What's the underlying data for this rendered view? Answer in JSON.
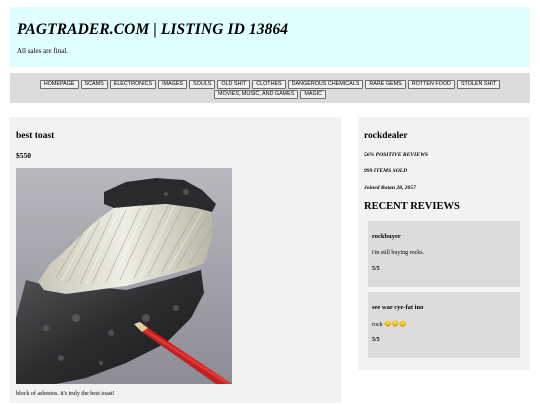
{
  "header": {
    "title": "PAGTRADER.COM | LISTING ID 13864",
    "subtitle": "All sales are final."
  },
  "nav": {
    "row1": [
      "HOMEPAGE",
      "SCAMS",
      "ELECTRONICS",
      "IMAGES",
      "SOULS",
      "OLD SHIT",
      "CLOTHES",
      "DANGEROUS CHEMICALS",
      "RARE GEMS",
      "ROTTEN FOOD",
      "STOLEN SHIT"
    ],
    "row2": [
      "MOVIES, MUSIC, AND GAMES",
      "MAGIC"
    ]
  },
  "listing": {
    "title": "best toast",
    "price": "$550",
    "description": "block of asbestos. it's truly the best toast!"
  },
  "seller": {
    "name": "rockdealer",
    "positive_reviews": "56% POSITIVE REVIEWS",
    "items_sold": "999 ITEMS SOLD",
    "joined": "Joined Botan 28, 2057",
    "reviews_heading": "RECENT REVIEWS",
    "reviews": [
      {
        "user": "rockbuyer",
        "text": "i'm still buying rocks.",
        "score": "5/5"
      },
      {
        "user": "see war cye-fat ino",
        "text": "rock 😔😔😔",
        "score": "5/5"
      }
    ]
  },
  "colors": {
    "header_bg": "#e0ffff",
    "nav_bg": "#dcdcdc",
    "panel_bg": "#f2f2f2",
    "review_bg": "#dcdcdc"
  }
}
